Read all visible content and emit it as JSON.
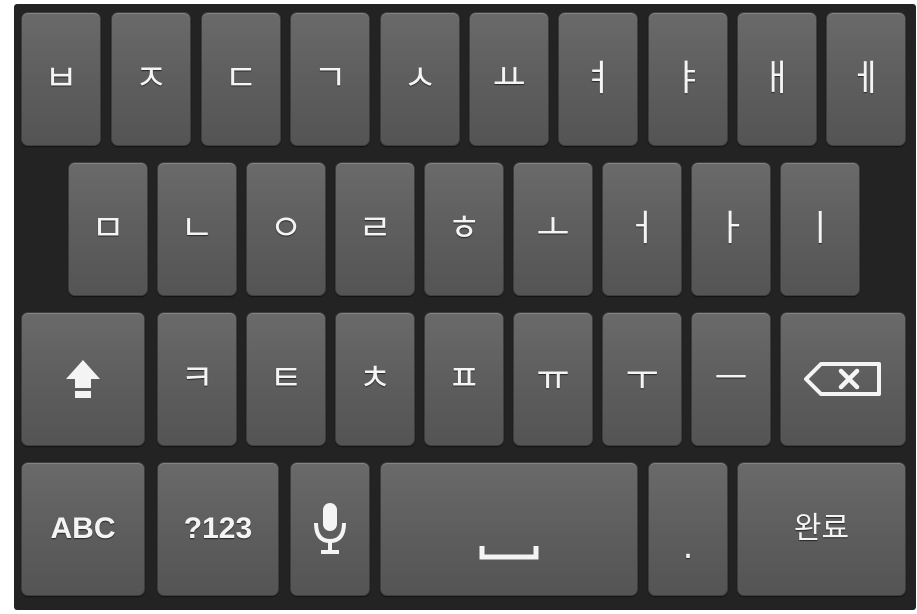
{
  "keyboard": {
    "rows": [
      [
        "ㅂ",
        "ㅈ",
        "ㄷ",
        "ㄱ",
        "ㅅ",
        "ㅛ",
        "ㅕ",
        "ㅑ",
        "ㅐ",
        "ㅔ"
      ],
      [
        "ㅁ",
        "ㄴ",
        "ㅇ",
        "ㄹ",
        "ㅎ",
        "ㅗ",
        "ㅓ",
        "ㅏ",
        "ㅣ"
      ],
      [
        "ㅋ",
        "ㅌ",
        "ㅊ",
        "ㅍ",
        "ㅠ",
        "ㅜ",
        "ㅡ"
      ]
    ],
    "abc_label": "ABC",
    "symbols_label": "?123",
    "period_label": ".",
    "done_label": "완료",
    "icons": {
      "shift": "shift-arrow-icon",
      "backspace": "backspace-icon",
      "mic": "microphone-icon",
      "space": "space-bar-icon"
    },
    "colors": {
      "background": "#222322",
      "key": "#5f5f5f",
      "label": "#f4f4f4"
    }
  }
}
